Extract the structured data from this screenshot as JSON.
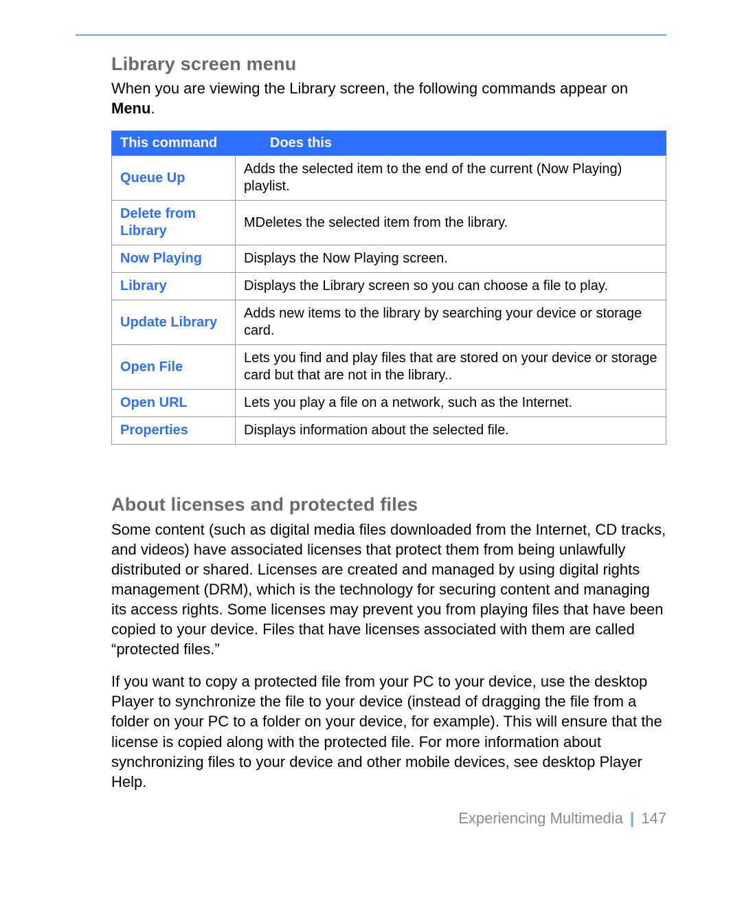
{
  "section1": {
    "heading": "Library screen menu",
    "intro_prefix": "When you are viewing the Library screen, the following commands appear on ",
    "intro_bold": "Menu",
    "intro_suffix": "."
  },
  "table": {
    "header_cmd": "This command",
    "header_does": "Does this",
    "rows": [
      {
        "cmd": "Queue Up",
        "desc": "Adds the selected item to the end of the current (Now Playing) playlist."
      },
      {
        "cmd": "Delete from Library",
        "desc": "MDeletes the selected item from the library."
      },
      {
        "cmd": "Now Playing",
        "desc": "Displays the Now Playing screen."
      },
      {
        "cmd": "Library",
        "desc": "Displays the Library screen so you can choose a file to play."
      },
      {
        "cmd": "Update Library",
        "desc": "Adds new items to the library by searching your device or storage card."
      },
      {
        "cmd": "Open File",
        "desc": "Lets you find and play files that are stored on your device or storage card but that are not in the library.."
      },
      {
        "cmd": "Open URL",
        "desc": "Lets you play a file on a network, such as the Internet."
      },
      {
        "cmd": "Properties",
        "desc": "Displays information about the selected file."
      }
    ]
  },
  "section2": {
    "heading": "About licenses and protected files",
    "para1": "Some content (such as digital media files downloaded from the Internet, CD tracks, and videos) have associated licenses that protect them from being unlawfully distributed or shared. Licenses are created and managed by using digital rights management (DRM), which is the technology for securing content and managing its access rights. Some licenses may prevent you from playing files that have been copied to your device. Files that have licenses associated with them are called “protected files.”",
    "para2": "If you want to copy a protected file from your PC to your device, use the desktop Player to synchronize the file to your device (instead of dragging the file from a folder on your PC to a folder on your device, for example). This will ensure that the license is copied along with the protected file. For more information about synchronizing files to your device and other mobile devices, see desktop Player Help."
  },
  "footer": {
    "chapter": "Experiencing Multimedia",
    "sep": "|",
    "page": "147"
  }
}
